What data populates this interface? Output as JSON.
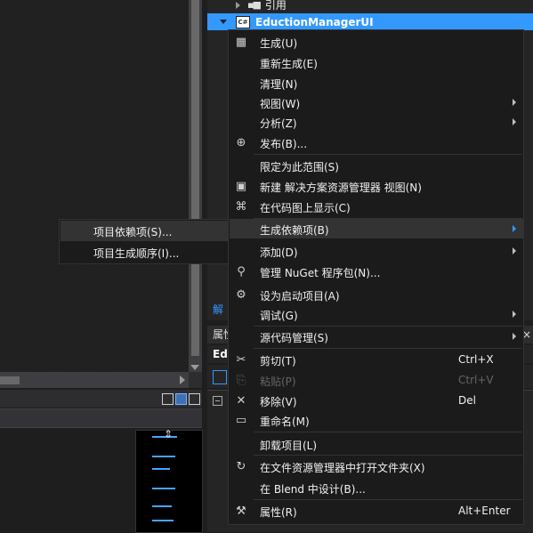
{
  "solution_explorer": {
    "references_label": "引用",
    "project_name": "EductionManagerUI",
    "project_icon_text": "C#",
    "tab_label_partial": "解"
  },
  "properties": {
    "title_partial": "属性",
    "object_name_partial": "Ed",
    "close_glyph": "×"
  },
  "context_menu": {
    "items": [
      {
        "label": "生成(U)",
        "icon": "build-icon",
        "glyph": "▦"
      },
      {
        "label": "重新生成(E)"
      },
      {
        "label": "清理(N)"
      },
      {
        "label": "视图(W)",
        "has_submenu": true
      },
      {
        "label": "分析(Z)",
        "has_submenu": true
      },
      {
        "label": "发布(B)...",
        "icon": "globe-icon",
        "glyph": "⊕"
      },
      {
        "label": "限定为此范围(S)"
      },
      {
        "label": "新建 解决方案资源管理器 视图(N)",
        "icon": "new-view-icon",
        "glyph": "▣"
      },
      {
        "label": "在代码图上显示(C)",
        "icon": "code-map-icon",
        "glyph": "⌘"
      },
      {
        "label": "生成依赖项(B)",
        "has_submenu": true
      },
      {
        "label": "添加(D)",
        "has_submenu": true
      },
      {
        "label": "管理 NuGet 程序包(N)...",
        "icon": "nuget-icon",
        "glyph": "⚲"
      },
      {
        "label": "设为启动项目(A)",
        "icon": "gear-icon",
        "glyph": "⚙"
      },
      {
        "label": "调试(G)",
        "has_submenu": true
      },
      {
        "label": "源代码管理(S)",
        "has_submenu": true
      },
      {
        "label": "剪切(T)",
        "shortcut": "Ctrl+X",
        "icon": "scissors-icon",
        "glyph": "✂"
      },
      {
        "label": "粘贴(P)",
        "shortcut": "Ctrl+V",
        "icon": "paste-icon",
        "glyph": "⎘",
        "disabled": true
      },
      {
        "label": "移除(V)",
        "shortcut": "Del",
        "icon": "remove-icon",
        "glyph": "✕"
      },
      {
        "label": "重命名(M)",
        "icon": "rename-icon",
        "glyph": "▭"
      },
      {
        "label": "卸载项目(L)"
      },
      {
        "label": "在文件资源管理器中打开文件夹(X)",
        "icon": "refresh-icon",
        "glyph": "↻"
      },
      {
        "label": "在 Blend 中设计(B)..."
      },
      {
        "label": "属性(R)",
        "shortcut": "Alt+Enter",
        "icon": "wrench-icon",
        "glyph": "🔧"
      }
    ]
  },
  "submenu": {
    "items": [
      {
        "label": "项目依赖项(S)..."
      },
      {
        "label": "项目生成顺序(I)..."
      }
    ]
  },
  "colors": {
    "accent": "#3399ff",
    "menu_bg": "#1b1b1c",
    "hover_bg": "#333334"
  }
}
